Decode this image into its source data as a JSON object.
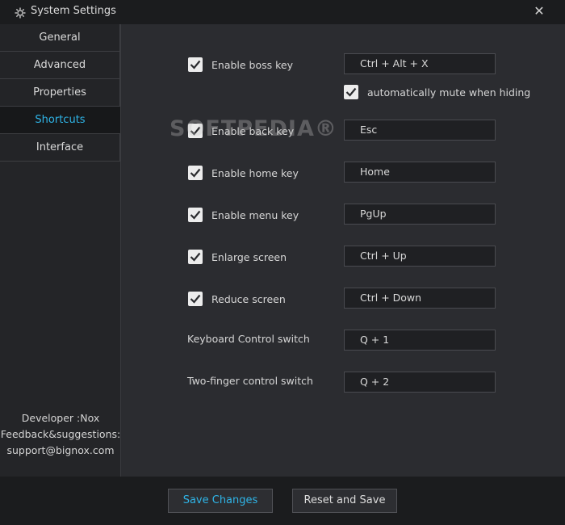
{
  "window": {
    "title": "System Settings",
    "close_glyph": "✕"
  },
  "sidebar": {
    "items": [
      {
        "label": "General"
      },
      {
        "label": "Advanced"
      },
      {
        "label": "Properties"
      },
      {
        "label": "Shortcuts",
        "active": true
      },
      {
        "label": "Interface"
      }
    ],
    "developer": "Developer :Nox",
    "feedback": "Feedback&suggestions:",
    "email": "support@bignox.com"
  },
  "shortcuts": {
    "boss_key": {
      "label": "Enable boss key",
      "checked": true,
      "value": "Ctrl + Alt + X"
    },
    "mute_when_hiding": {
      "label": "automatically mute when hiding",
      "checked": true
    },
    "back_key": {
      "label": "Enable back key",
      "checked": true,
      "value": "Esc"
    },
    "home_key": {
      "label": "Enable home key",
      "checked": true,
      "value": "Home"
    },
    "menu_key": {
      "label": "Enable menu key",
      "checked": true,
      "value": "PgUp"
    },
    "enlarge_screen": {
      "label": "Enlarge screen",
      "checked": true,
      "value": "Ctrl + Up"
    },
    "reduce_screen": {
      "label": "Reduce screen",
      "checked": true,
      "value": "Ctrl + Down"
    },
    "keyboard_control": {
      "label": "Keyboard Control switch",
      "value": "Q + 1"
    },
    "two_finger_control": {
      "label": "Two-finger control switch",
      "value": "Q + 2"
    }
  },
  "watermark": "SOFTPEDIA®",
  "footer": {
    "save_label": "Save Changes",
    "reset_label": "Reset and Save"
  },
  "colors": {
    "accent": "#2fb5e8",
    "background": "#2b2c30",
    "sidebar": "#242528"
  }
}
